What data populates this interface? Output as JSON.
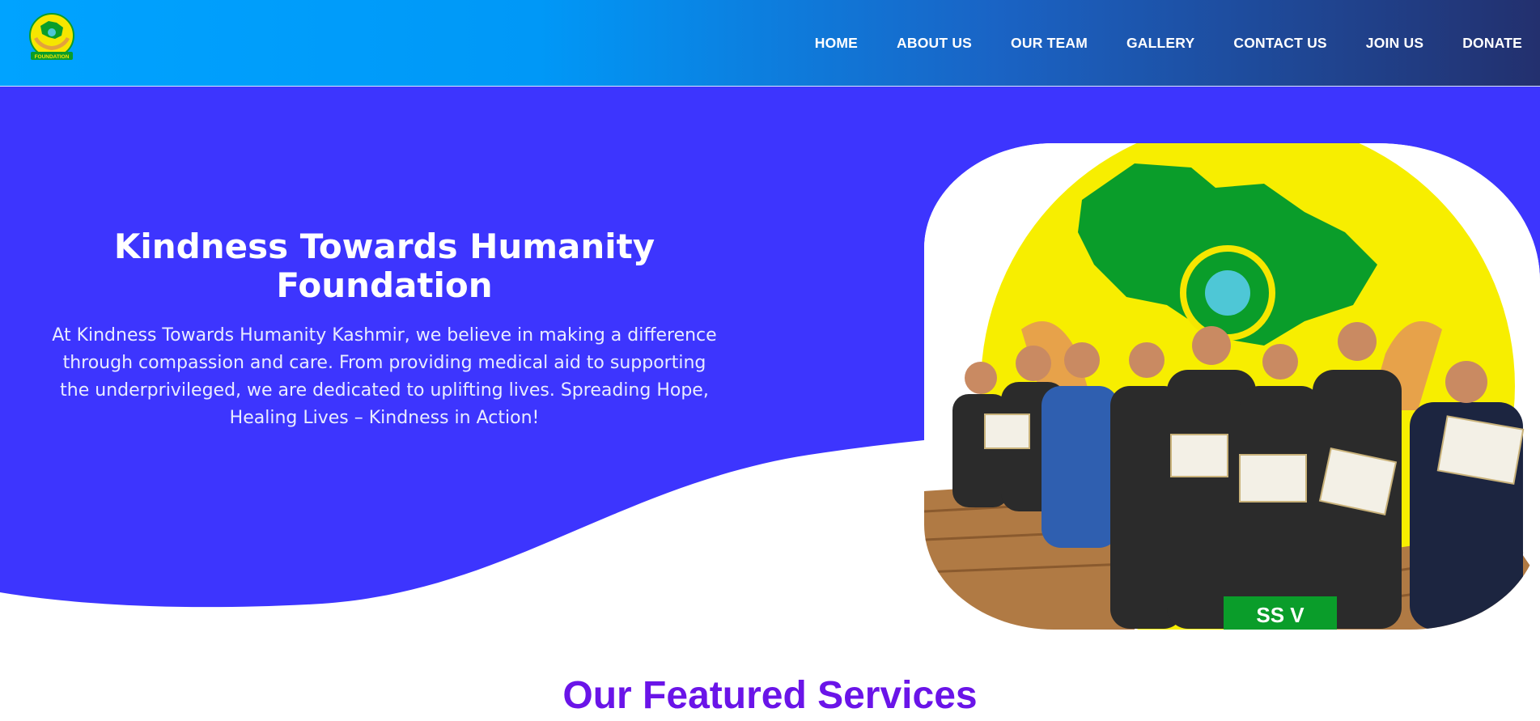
{
  "brand": {
    "logo_icon": "khtf-logo-icon",
    "logo_text": "FOUNDATION",
    "colors": {
      "header_start": "#00a3ff",
      "header_end": "#23306e",
      "hero_bg": "#3d35fe",
      "accent_purple": "#6a14e8",
      "logo_yellow": "#f6e600",
      "logo_green": "#0a9d2a"
    }
  },
  "nav": {
    "items": [
      {
        "label": "HOME"
      },
      {
        "label": "ABOUT US"
      },
      {
        "label": "OUR TEAM"
      },
      {
        "label": "GALLERY"
      },
      {
        "label": "CONTACT US"
      },
      {
        "label": "JOIN US"
      },
      {
        "label": "DONATE"
      }
    ]
  },
  "hero": {
    "title": "Kindness Towards Humanity Foundation",
    "description": "At Kindness Towards Humanity Kashmir, we believe in making a difference through compassion and care. From providing medical aid to supporting the underprivileged, we are dedicated to uplifting lives. Spreading Hope, Healing Lives – Kindness in Action!",
    "image": "team-group-photo-with-certificates"
  },
  "featured": {
    "title": "Our Featured Services"
  }
}
